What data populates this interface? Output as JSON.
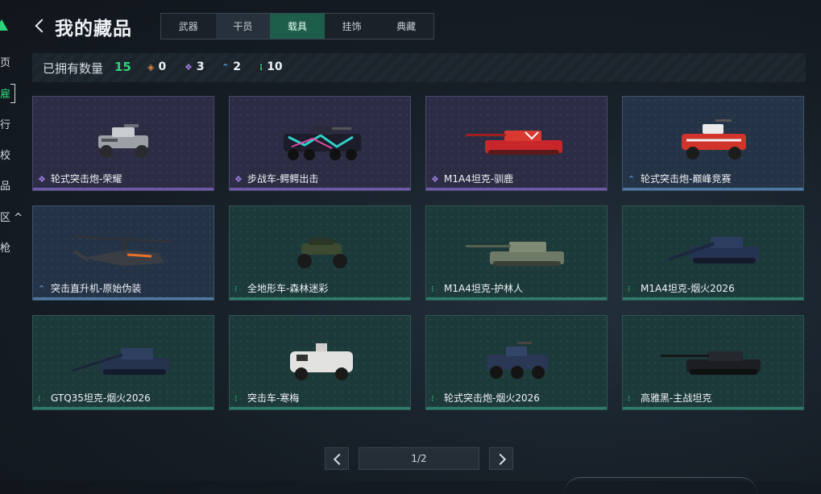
{
  "sidebar": {
    "items": [
      {
        "label": "页"
      },
      {
        "label": "雇"
      },
      {
        "label": "行"
      },
      {
        "label": "校"
      },
      {
        "label": "品"
      },
      {
        "label": "区 ^"
      },
      {
        "label": "枪"
      }
    ]
  },
  "header": {
    "title": "我的藏品",
    "tabs": [
      {
        "label": "武器"
      },
      {
        "label": "干员"
      },
      {
        "label": "载具"
      },
      {
        "label": "挂饰"
      },
      {
        "label": "典藏"
      }
    ]
  },
  "owned": {
    "label": "已拥有数量",
    "count": "15",
    "rarities": [
      {
        "icon": "orange-diamond-icon",
        "color": "#d98a3a",
        "value": "0"
      },
      {
        "icon": "purple-diamond-icon",
        "color": "#9b7de0",
        "value": "3"
      },
      {
        "icon": "blue-chevron-icon",
        "color": "#5aa8e6",
        "value": "2"
      },
      {
        "icon": "green-dots-icon",
        "color": "#2fd27b",
        "value": "10"
      }
    ]
  },
  "items": [
    {
      "name": "轮式突击炮-荣耀",
      "rarity": "purple"
    },
    {
      "name": "步战车-鳄鳄出击",
      "rarity": "purple"
    },
    {
      "name": "M1A4坦克-驯鹿",
      "rarity": "purple"
    },
    {
      "name": "轮式突击炮-巅峰竞赛",
      "rarity": "blue"
    },
    {
      "name": "突击直升机-原始伪装",
      "rarity": "blue"
    },
    {
      "name": "全地形车-森林迷彩",
      "rarity": "green"
    },
    {
      "name": "M1A4坦克-护林人",
      "rarity": "green"
    },
    {
      "name": "M1A4坦克-烟火2026",
      "rarity": "green"
    },
    {
      "name": "GTQ35坦克-烟火2026",
      "rarity": "green"
    },
    {
      "name": "突击车-寒梅",
      "rarity": "green"
    },
    {
      "name": "轮式突击炮-烟火2026",
      "rarity": "green"
    },
    {
      "name": "高雅黑-主战坦克",
      "rarity": "green"
    }
  ],
  "pager": {
    "page": "1/2"
  }
}
